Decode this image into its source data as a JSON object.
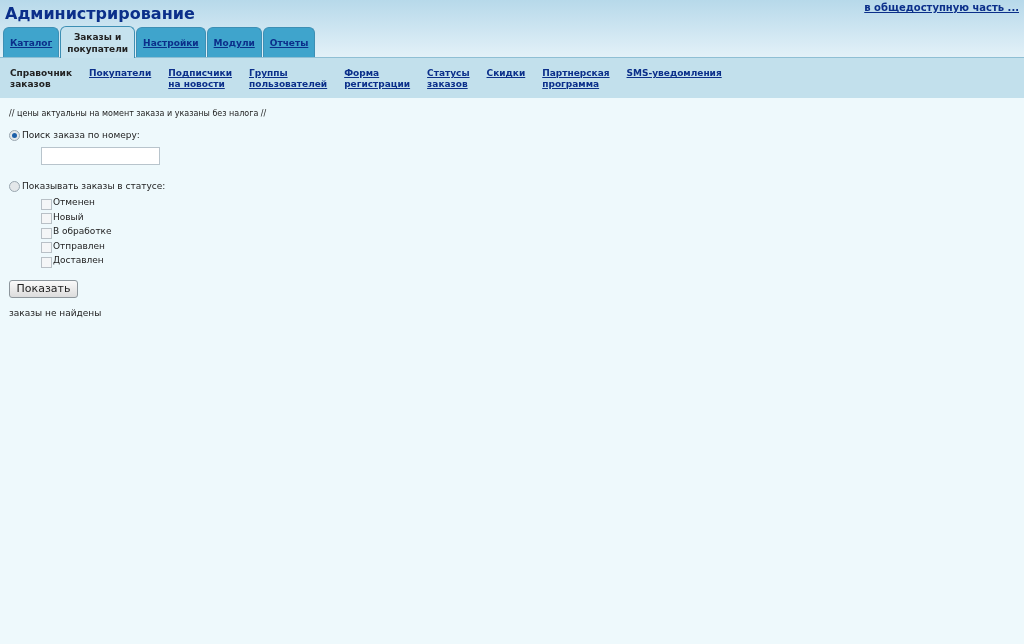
{
  "header": {
    "title": "Администрирование",
    "public_link": "в общедоступную часть ..."
  },
  "tabs": [
    {
      "label": "Каталог",
      "selected": false
    },
    {
      "label": "Заказы и\nпокупатели",
      "selected": true
    },
    {
      "label": "Настройки",
      "selected": false
    },
    {
      "label": "Модули",
      "selected": false
    },
    {
      "label": "Отчеты",
      "selected": false
    }
  ],
  "subnav": [
    {
      "label": "Справочник\nзаказов",
      "selected": true
    },
    {
      "label": "Покупатели",
      "selected": false
    },
    {
      "label": "Подписчики\nна новости",
      "selected": false
    },
    {
      "label": "Группы\nпользователей",
      "selected": false
    },
    {
      "label": "Форма\nрегистрации",
      "selected": false
    },
    {
      "label": "Статусы\nзаказов",
      "selected": false
    },
    {
      "label": "Скидки",
      "selected": false
    },
    {
      "label": "Партнерская\nпрограмма",
      "selected": false
    },
    {
      "label": "SMS-уведомления",
      "selected": false
    }
  ],
  "note": "// цены актуальны на момент заказа и указаны без налога //",
  "search_mode": {
    "label": "Поиск заказа по номеру:",
    "selected": true
  },
  "status_mode": {
    "label": "Показывать заказы в статусе:",
    "selected": false
  },
  "statuses": [
    {
      "label": "Отменен",
      "checked": false
    },
    {
      "label": "Новый",
      "checked": false
    },
    {
      "label": "В обработке",
      "checked": false
    },
    {
      "label": "Отправлен",
      "checked": false
    },
    {
      "label": "Доставлен",
      "checked": false
    }
  ],
  "show_button": "Показать",
  "result": "заказы не найдены"
}
